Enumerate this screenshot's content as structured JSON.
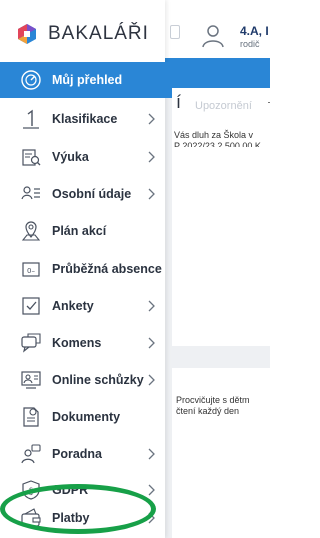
{
  "brand": {
    "name": "BAKALÁŘI"
  },
  "user": {
    "name": "4.A, I",
    "role": "rodič"
  },
  "sidebar": {
    "items": [
      {
        "label": "Můj přehled",
        "icon": "gauge-icon",
        "chevron": false,
        "active": true
      },
      {
        "label": "Klasifikace",
        "icon": "grade-one-icon",
        "chevron": true
      },
      {
        "label": "Výuka",
        "icon": "book-search-icon",
        "chevron": true
      },
      {
        "label": "Osobní údaje",
        "icon": "id-list-icon",
        "chevron": true
      },
      {
        "label": "Plán akcí",
        "icon": "map-pin-icon",
        "chevron": false
      },
      {
        "label": "Průběžná absence",
        "icon": "absence-card-icon",
        "chevron": false
      },
      {
        "label": "Ankety",
        "icon": "checkbox-icon",
        "chevron": true
      },
      {
        "label": "Komens",
        "icon": "chat-bubbles-icon",
        "chevron": true
      },
      {
        "label": "Online schůzky",
        "icon": "video-meeting-icon",
        "chevron": true
      },
      {
        "label": "Dokumenty",
        "icon": "document-icon",
        "chevron": false
      },
      {
        "label": "Poradna",
        "icon": "advice-icon",
        "chevron": true
      },
      {
        "label": "GDPR",
        "icon": "shield-icon",
        "chevron": true
      },
      {
        "label": "Platby",
        "icon": "wallet-icon",
        "chevron": true
      }
    ]
  },
  "main": {
    "heading_fragment": "í",
    "faded_title": "Upozornění",
    "debt_line1": "Vás dluh za Škola v",
    "debt_line2": "P 2022/23 2 500,00 K",
    "read_line1": "Procvičujte s dětm",
    "read_line2": "čtení každý den"
  },
  "colors": {
    "accent": "#2a86d6",
    "highlight_ring": "#17a048"
  }
}
